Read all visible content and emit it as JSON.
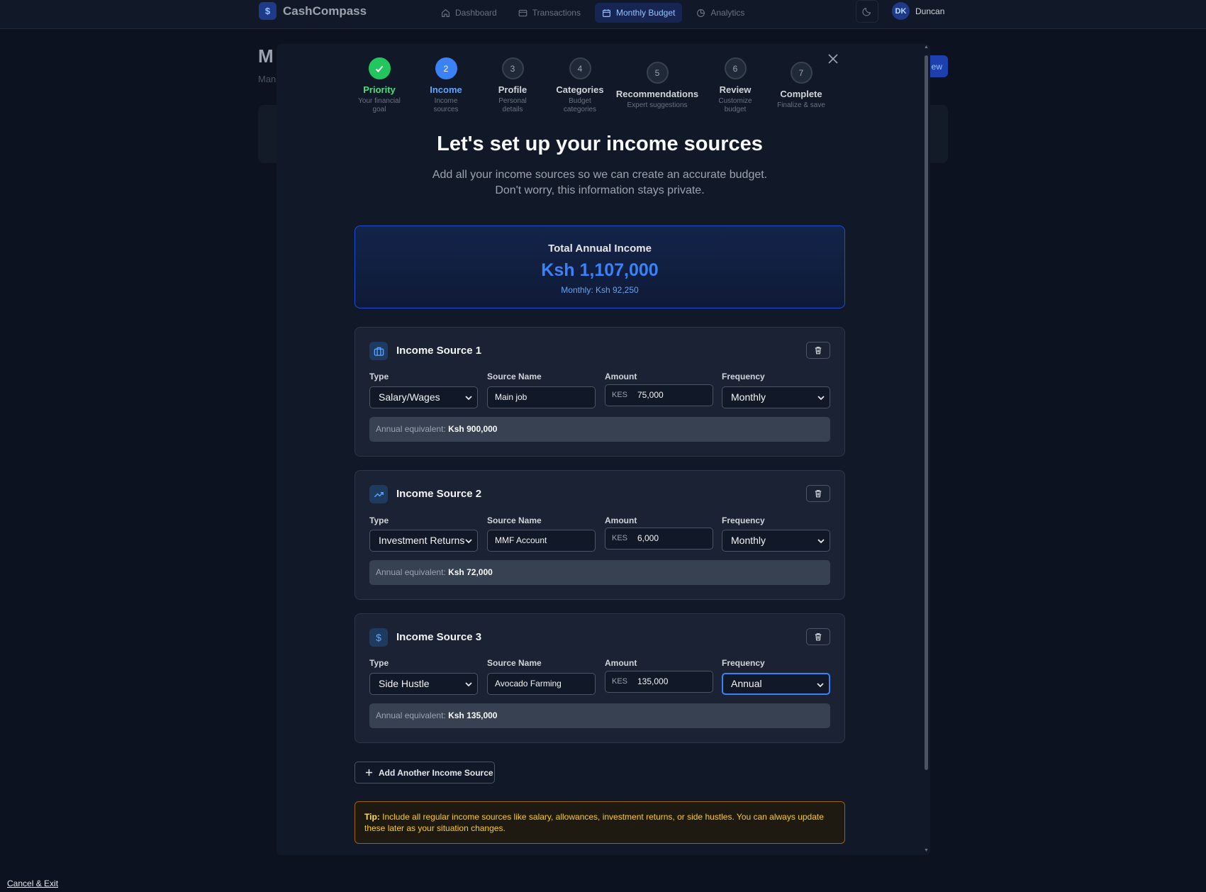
{
  "app": {
    "logo_glyph": "$",
    "name": "CashCompass",
    "nav": [
      {
        "label": "Dashboard",
        "icon": "home-icon"
      },
      {
        "label": "Transactions",
        "icon": "card-icon"
      },
      {
        "label": "Monthly Budget",
        "icon": "calendar-icon",
        "active": true
      },
      {
        "label": "Analytics",
        "icon": "pie-chart-icon"
      }
    ],
    "theme_icon": "moon-icon",
    "user_initials": "DK",
    "user_name": "Duncan"
  },
  "background_page": {
    "title_fragment": "M",
    "subtitle_fragment": "Man",
    "new_button_fragment": "ew"
  },
  "wizard": {
    "steps": [
      {
        "number": "1",
        "label": "Priority",
        "desc": "Your financial goal",
        "state": "done"
      },
      {
        "number": "2",
        "label": "Income",
        "desc": "Income sources",
        "state": "current"
      },
      {
        "number": "3",
        "label": "Profile",
        "desc": "Personal details",
        "state": "pending"
      },
      {
        "number": "4",
        "label": "Categories",
        "desc": "Budget categories",
        "state": "pending"
      },
      {
        "number": "5",
        "label": "Recommendations",
        "desc": "Expert suggestions",
        "state": "pending"
      },
      {
        "number": "6",
        "label": "Review",
        "desc": "Customize budget",
        "state": "pending"
      },
      {
        "number": "7",
        "label": "Complete",
        "desc": "Finalize & save",
        "state": "pending"
      }
    ],
    "title": "Let's set up your income sources",
    "subtitle_line1": "Add all your income sources so we can create an accurate budget.",
    "subtitle_line2": "Don't worry, this information stays private.",
    "total": {
      "label": "Total Annual Income",
      "value": "Ksh 1,107,000",
      "monthly": "Monthly: Ksh 92,250"
    },
    "field_labels": {
      "type": "Type",
      "source_name": "Source Name",
      "amount": "Amount",
      "frequency": "Frequency"
    },
    "currency": "KES",
    "annual_prefix": "Annual equivalent:",
    "sources": [
      {
        "title": "Income Source 1",
        "icon": "briefcase-icon",
        "type": "Salary/Wages",
        "name": "Main job",
        "amount": "75,000",
        "frequency": "Monthly",
        "annual": "Ksh 900,000"
      },
      {
        "title": "Income Source 2",
        "icon": "trending-up-icon",
        "type": "Investment Returns",
        "name": "MMF Account",
        "amount": "6,000",
        "frequency": "Monthly",
        "annual": "Ksh 72,000"
      },
      {
        "title": "Income Source 3",
        "icon": "dollar-icon",
        "type": "Side Hustle",
        "name": "Avocado Farming",
        "amount": "135,000",
        "frequency": "Annual",
        "annual": "Ksh 135,000"
      }
    ],
    "add_button": "Add Another Income Source",
    "tip_label": "Tip:",
    "tip_text": "Include all regular income sources like salary, allowances, investment returns, or side hustles. You can always update these later as your situation changes."
  },
  "cancel_exit": "Cancel & Exit",
  "colors": {
    "accent": "#3b82f6",
    "success": "#22c55e",
    "tip": "#facc15",
    "background": "#0c1220"
  }
}
